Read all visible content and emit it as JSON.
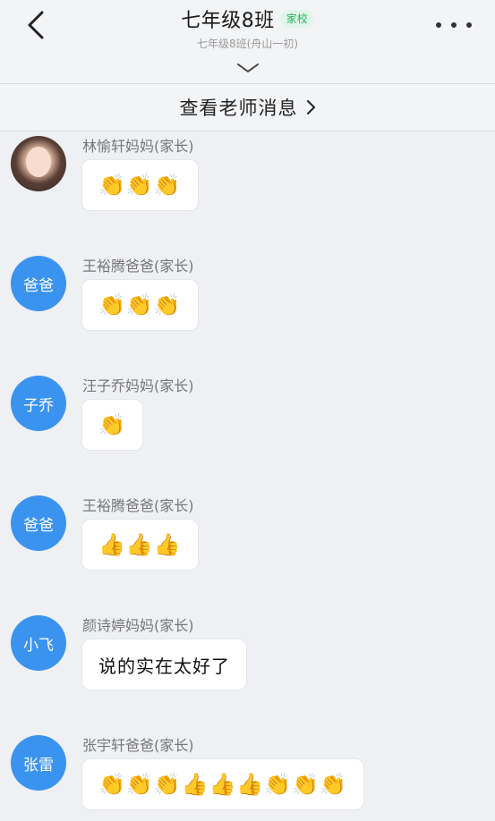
{
  "header": {
    "title": "七年级8班",
    "badge": "家校",
    "subtitle": "七年级8班(舟山一初)",
    "back_icon": "chevron-left-icon",
    "more_icon": "more-icon",
    "expand_icon": "chevron-down-icon"
  },
  "teacher_bar": {
    "label": "查看老师消息",
    "arrow": "›"
  },
  "messages": [
    {
      "sender": "林愉轩妈妈(家长)",
      "avatar_text": "",
      "avatar_type": "photo",
      "content": "👏👏👏"
    },
    {
      "sender": "王裕腾爸爸(家长)",
      "avatar_text": "爸爸",
      "avatar_type": "text",
      "content": "👏👏👏"
    },
    {
      "sender": "汪子乔妈妈(家长)",
      "avatar_text": "子乔",
      "avatar_type": "text",
      "content": "👏"
    },
    {
      "sender": "王裕腾爸爸(家长)",
      "avatar_text": "爸爸",
      "avatar_type": "text",
      "content": "👍👍👍"
    },
    {
      "sender": "颜诗婷妈妈(家长)",
      "avatar_text": "小飞",
      "avatar_type": "text",
      "content": "说的实在太好了"
    },
    {
      "sender": "张宇轩爸爸(家长)",
      "avatar_text": "张雷",
      "avatar_type": "text",
      "content": "👏👏👏👍👍👍👏👏👏"
    }
  ],
  "colors": {
    "avatar_blue": "#3b93f0",
    "badge_green": "#28b35a",
    "background": "#eef0f3"
  }
}
